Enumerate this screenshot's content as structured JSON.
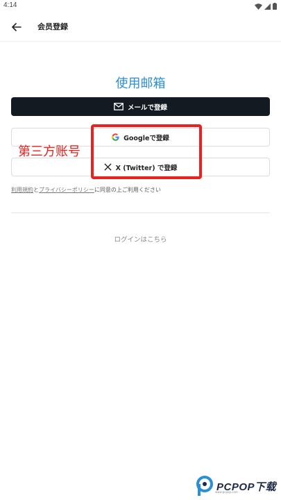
{
  "status_bar": {
    "time": "4:14"
  },
  "app_bar": {
    "title": "会员登録"
  },
  "overlay": {
    "email_label": "使用邮箱",
    "third_party_label": "第三方账号"
  },
  "buttons": {
    "email": "メールで登録",
    "google": "Googleで登録",
    "x": "X (Twitter) で登録"
  },
  "terms": {
    "link1": "利用規約",
    "mid": "と",
    "link2": "プライバシーポリシー",
    "suffix": "に同意の上ご利用ください"
  },
  "login_link": "ログインはこちら",
  "watermark": {
    "brand": "PCPOP下载",
    "sub": "www.pcpop.com"
  },
  "colors": {
    "accent_blue": "#2a8fd6",
    "annotation_red": "#e8231f",
    "dark_button": "#141a22"
  }
}
